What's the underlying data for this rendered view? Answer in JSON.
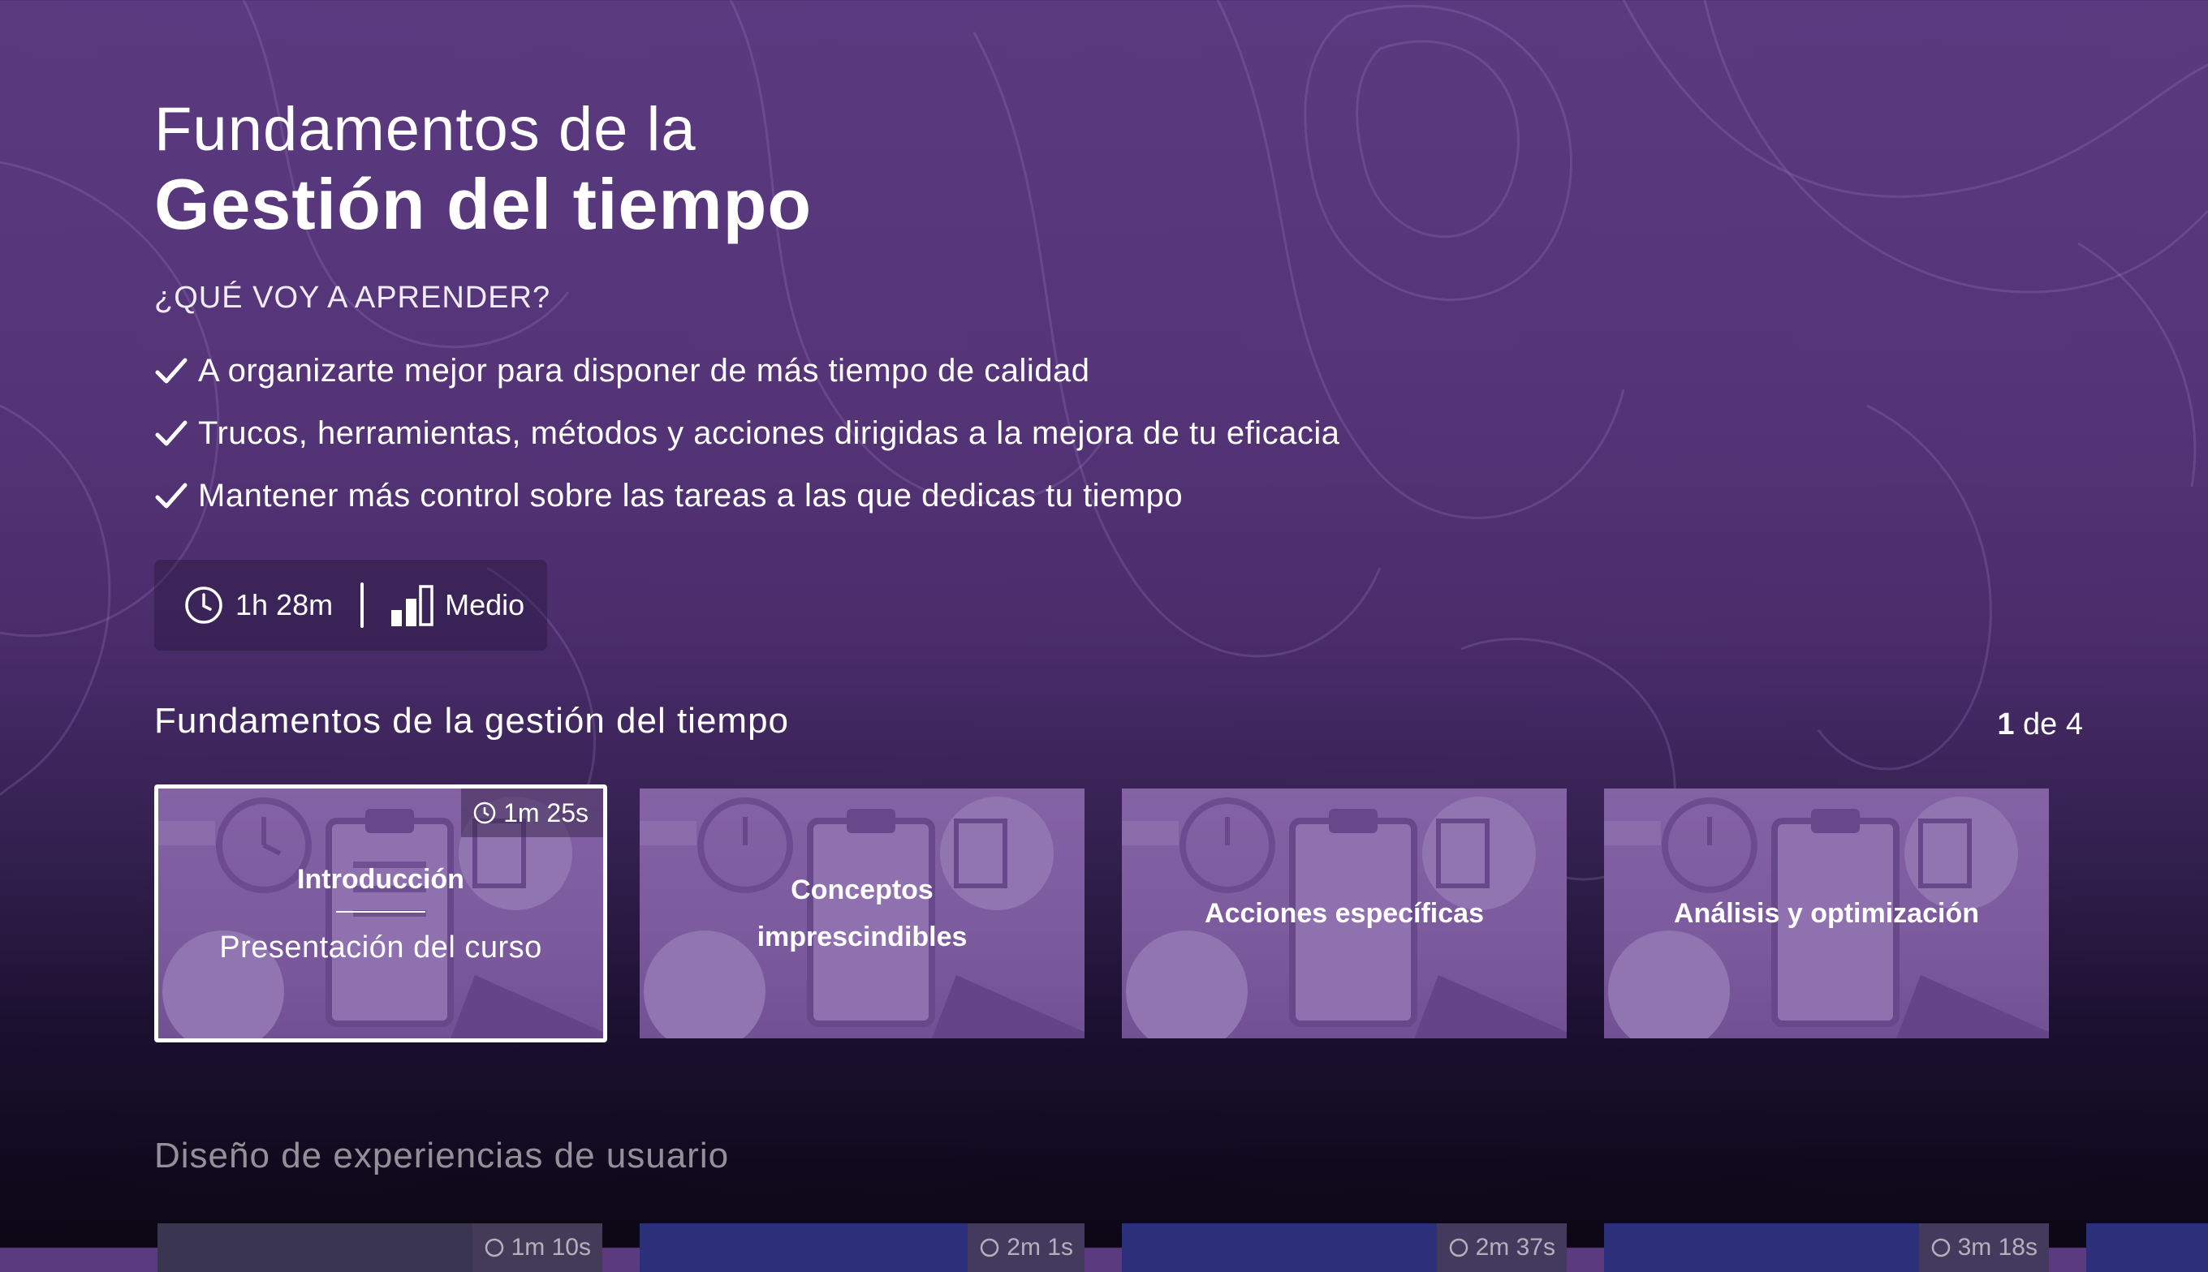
{
  "hero": {
    "title_line1": "Fundamentos de la",
    "title_line2": "Gestión del tiempo",
    "learn_heading": "¿QUÉ VOY A APRENDER?",
    "points": [
      "A organizarte mejor para disponer de más tiempo de calidad",
      "Trucos, herramientas, métodos y acciones dirigidas a la mejora de tu eficacia",
      "Mantener más control sobre las tareas a las que dedicas tu tiempo"
    ]
  },
  "meta": {
    "duration": "1h 28m",
    "level": "Medio",
    "icons": [
      "clock-icon",
      "level-bars-icon"
    ]
  },
  "row1": {
    "title": "Fundamentos de la gestión del tiempo",
    "counter_current": "1",
    "counter_rest": " de 4",
    "cards": [
      {
        "kicker": "Introducción",
        "subtitle": "Presentación del curso",
        "duration": "1m 25s"
      },
      {
        "label": "Conceptos imprescindibles"
      },
      {
        "label": "Acciones específicas"
      },
      {
        "label": "Análisis y optimización"
      }
    ]
  },
  "row2": {
    "title": "Diseño de experiencias de usuario",
    "durations": [
      "1m 10s",
      "2m 1s",
      "2m 37s",
      "3m 18s"
    ]
  },
  "colors": {
    "bg_top": "#5b3a80",
    "bg_bottom": "#0b0714",
    "card": "#8a69a8",
    "focus_border": "#ffffff"
  }
}
